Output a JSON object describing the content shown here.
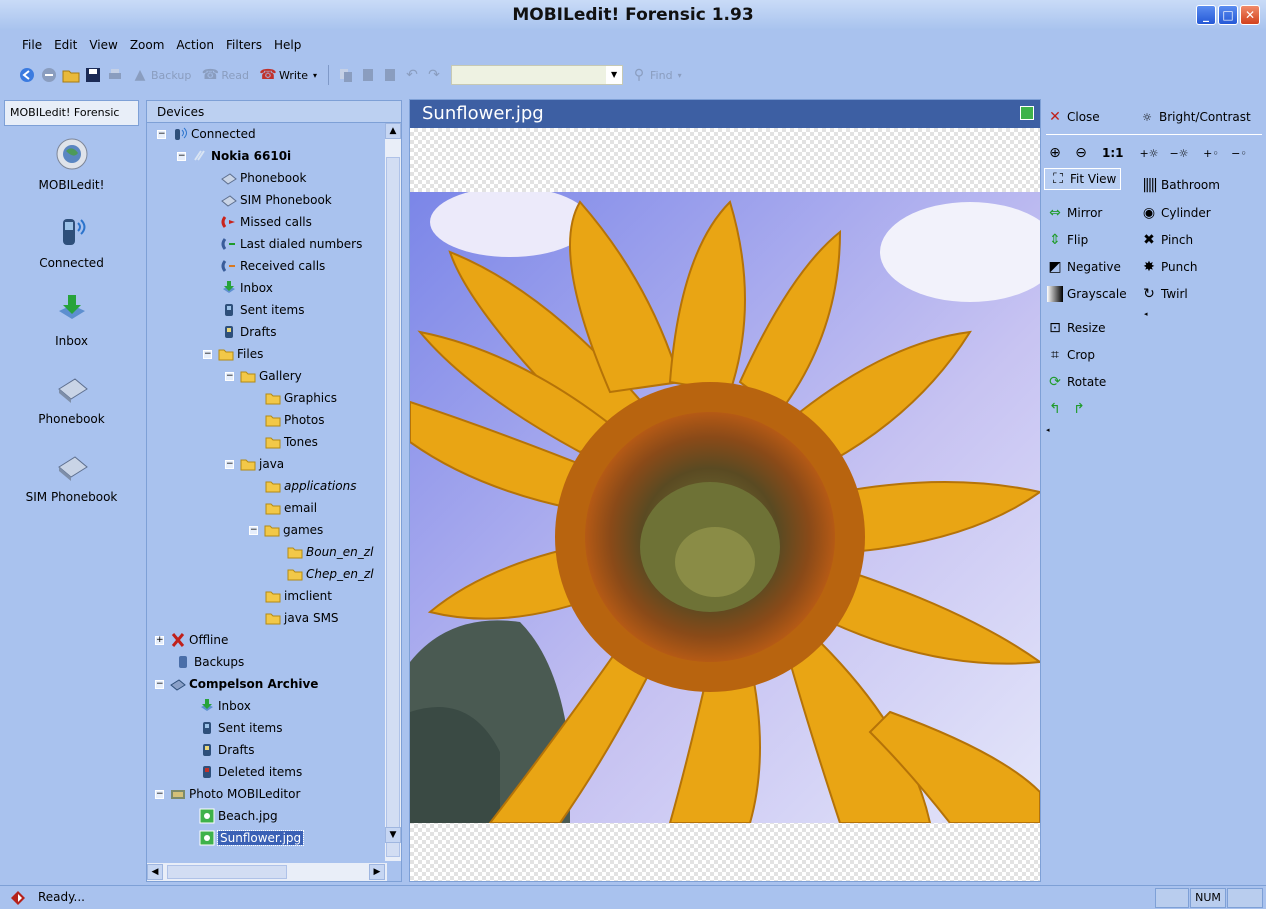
{
  "window": {
    "title": "MOBILedit! Forensic 1.93"
  },
  "menu": [
    "File",
    "Edit",
    "View",
    "Zoom",
    "Action",
    "Filters",
    "Help"
  ],
  "toolbar": {
    "backup": "Backup",
    "read": "Read",
    "write": "Write",
    "find": "Find",
    "combo_value": ""
  },
  "leftnav": {
    "header": "MOBILedit! Forensic",
    "items": [
      "MOBILedit!",
      "Connected",
      "Inbox",
      "Phonebook",
      "SIM Phonebook"
    ]
  },
  "tree": {
    "header": "Devices",
    "rows": [
      {
        "label": "Connected"
      },
      {
        "label": "Nokia 6610i"
      },
      {
        "label": "Phonebook"
      },
      {
        "label": "SIM Phonebook"
      },
      {
        "label": "Missed calls"
      },
      {
        "label": "Last dialed numbers"
      },
      {
        "label": "Received calls"
      },
      {
        "label": "Inbox"
      },
      {
        "label": "Sent items"
      },
      {
        "label": "Drafts"
      },
      {
        "label": "Files"
      },
      {
        "label": "Gallery"
      },
      {
        "label": "Graphics"
      },
      {
        "label": "Photos"
      },
      {
        "label": "Tones"
      },
      {
        "label": "java"
      },
      {
        "label": "applications"
      },
      {
        "label": "email"
      },
      {
        "label": "games"
      },
      {
        "label": "Boun_en_zl"
      },
      {
        "label": "Chep_en_zl"
      },
      {
        "label": "imclient"
      },
      {
        "label": "java SMS"
      },
      {
        "label": "Offline"
      },
      {
        "label": "Backups"
      },
      {
        "label": "Compelson Archive"
      },
      {
        "label": "Inbox"
      },
      {
        "label": "Sent items"
      },
      {
        "label": "Drafts"
      },
      {
        "label": "Deleted items"
      },
      {
        "label": "Photo MOBILeditor"
      },
      {
        "label": "Beach.jpg"
      },
      {
        "label": "Sunflower.jpg"
      }
    ]
  },
  "viewer": {
    "title": "Sunflower.jpg"
  },
  "tools": {
    "close": "Close",
    "bright_contrast": "Bright/Contrast",
    "zoom_1to1": "1:1",
    "fit_view": "Fit View",
    "bathroom": "Bathroom",
    "mirror": "Mirror",
    "cylinder": "Cylinder",
    "flip": "Flip",
    "pinch": "Pinch",
    "negative": "Negative",
    "punch": "Punch",
    "grayscale": "Grayscale",
    "twirl": "Twirl",
    "resize": "Resize",
    "crop": "Crop",
    "rotate": "Rotate"
  },
  "status": {
    "text": "Ready...",
    "num": "NUM"
  }
}
